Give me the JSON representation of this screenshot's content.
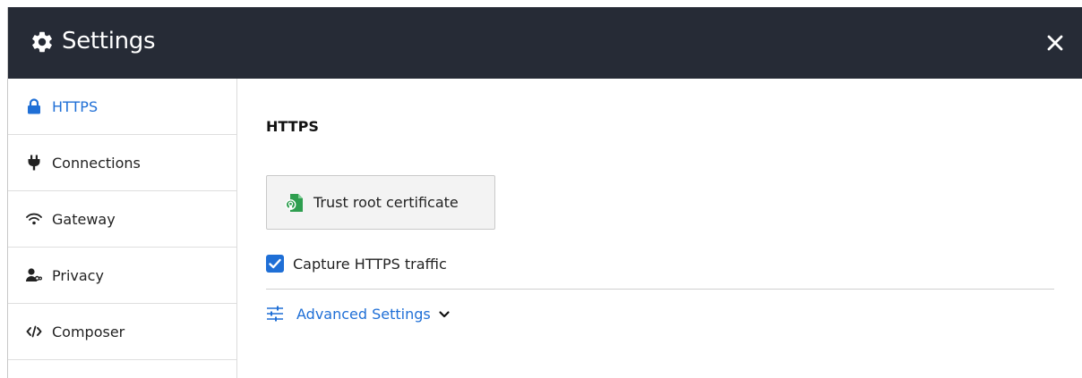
{
  "window": {
    "title": "Settings",
    "title_icon": "gear-icon",
    "close_icon": "close-icon"
  },
  "sidebar": {
    "items": [
      {
        "label": "HTTPS",
        "icon": "lock-icon",
        "active": true
      },
      {
        "label": "Connections",
        "icon": "plug-icon",
        "active": false
      },
      {
        "label": "Gateway",
        "icon": "wifi-icon",
        "active": false
      },
      {
        "label": "Privacy",
        "icon": "user-mask-icon",
        "active": false
      },
      {
        "label": "Composer",
        "icon": "code-icon",
        "active": false
      }
    ]
  },
  "main": {
    "section_title": "HTTPS",
    "trust_button_label": "Trust root certificate",
    "trust_button_icon": "certificate-icon",
    "capture_checkbox": {
      "label": "Capture HTTPS traffic",
      "checked": true
    },
    "advanced": {
      "label": "Advanced Settings",
      "icon": "sliders-icon",
      "expanded": false
    }
  },
  "colors": {
    "titlebar": "#262b36",
    "accent": "#1f6fd6",
    "certificate_green": "#2e9e4f"
  }
}
